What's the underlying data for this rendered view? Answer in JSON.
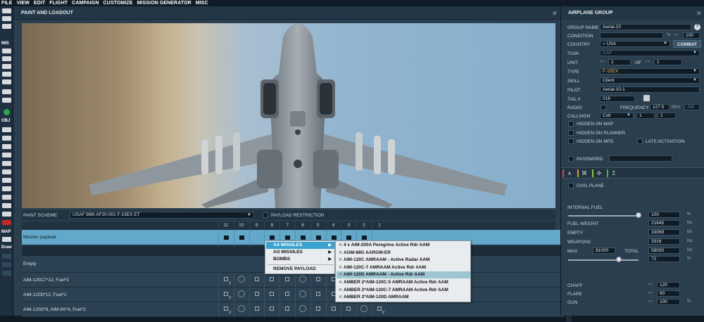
{
  "menubar": {
    "items": [
      "FILE",
      "VIEW",
      "EDIT",
      "FLIGHT",
      "CAMPAIGN",
      "CUSTOMIZE",
      "MISSION GENERATOR",
      "MISC"
    ]
  },
  "toolbar": {
    "section_mis": "MIS",
    "section_obj": "OBJ",
    "section_map": "MAP",
    "draw_label": "Draw"
  },
  "paint": {
    "title": "PAINT AND LOADOUT",
    "close": "✕",
    "scheme_label": "PAINT SCHEME",
    "scheme_value": "USAF 96th AF20-001 F-15EX ET",
    "payload_restriction": "PAYLOAD RESTRICTION",
    "stations": [
      "11",
      "10",
      "9",
      "8",
      "7",
      "6",
      "5",
      "4",
      "3",
      "2",
      "1"
    ],
    "mission_payload": "Mission payload",
    "empty_row": "Empty",
    "loadouts": [
      {
        "name": "AIM-120C7*12, Fuel*2"
      },
      {
        "name": "AIM-120D*12, Fuel*2"
      },
      {
        "name": "AIM-120D*8, AIM-9X*4, Fuel*2"
      }
    ],
    "count_label": "2"
  },
  "context_menu": {
    "items": [
      "AA MISSILES",
      "AG MISSILES",
      "BOMBS",
      "REMOVE PAYLOAD"
    ],
    "submenu": [
      "4 x AIM-200A Peregrine Active Rdr AAM",
      "AGM-88G AARGM-ER",
      "AIM-120C AMRAAM - Active Radar AAM",
      "AIM-120C-7 AMRAAM Active Rdr AAM",
      "AIM-120D AMRAAM - Active Rdr AAM",
      "AMBER 2*AIM-120C-5 AMRAAM Active Rdr AAM",
      "AMBER 2*AIM-120C-7 AMRAAM Active Rdr AAM",
      "AMBER 2*AIM-120D AMRAAM"
    ]
  },
  "group": {
    "title": "AIRPLANE GROUP",
    "close": "✕",
    "help": "?",
    "labels": {
      "group_name": "GROUP NAME",
      "condition": "CONDITION",
      "country": "COUNTRY",
      "task": "TASK",
      "unit": "UNIT",
      "of": "OF",
      "type": "TYPE",
      "skill": "SKILL",
      "pilot": "PILOT",
      "tail": "TAIL #",
      "radio": "RADIO",
      "frequency": "FREQUENCY",
      "callsign": "CALLSIGN",
      "password": "PASSWORD",
      "civil_plane": "CIVIL PLANE",
      "internal_fuel": "INTERNAL FUEL",
      "fuel_weight": "FUEL WEIGHT",
      "empty": "EMPTY",
      "weapons": "WEAPONS",
      "max": "MAX",
      "total": "TOTAL",
      "chaff": "CHAFF",
      "flare": "FLARE",
      "gun": "GUN"
    },
    "values": {
      "group_name": "Aerial-10",
      "condition": "100",
      "country": "USA",
      "combat": "COMBAT",
      "task": "CAP",
      "unit": "1",
      "of": "1",
      "type": "F-15EX",
      "skill": "Client",
      "pilot": "Aerial-10-1",
      "tail": "016",
      "frequency": "127.5",
      "mhz": "MHz",
      "am": "AM",
      "callsign": "Colt",
      "callsign_n1": "1",
      "callsign_n2": "1",
      "internal_fuel": "100",
      "fuel_weight": "21645",
      "empty": "33069",
      "weapons": "3316",
      "max": "81000",
      "total": "58030",
      "payload_pct": "72",
      "chaff": "120",
      "flare": "60",
      "gun": "100"
    },
    "units": {
      "pct": "%",
      "lbs": "lbs"
    },
    "checks": {
      "hidden_map": "HIDDEN ON MAP",
      "hidden_planner": "HIDDEN ON PLANNER",
      "hidden_mfd": "HIDDEN ON MFD",
      "late_activation": "LATE ACTIVATION"
    },
    "internal_fuel_level": 1.0,
    "payload_level": 0.72,
    "tab_colors": [
      "#e0473c",
      "#e59a2b",
      "#8fc641",
      "#3bbd4e"
    ]
  }
}
